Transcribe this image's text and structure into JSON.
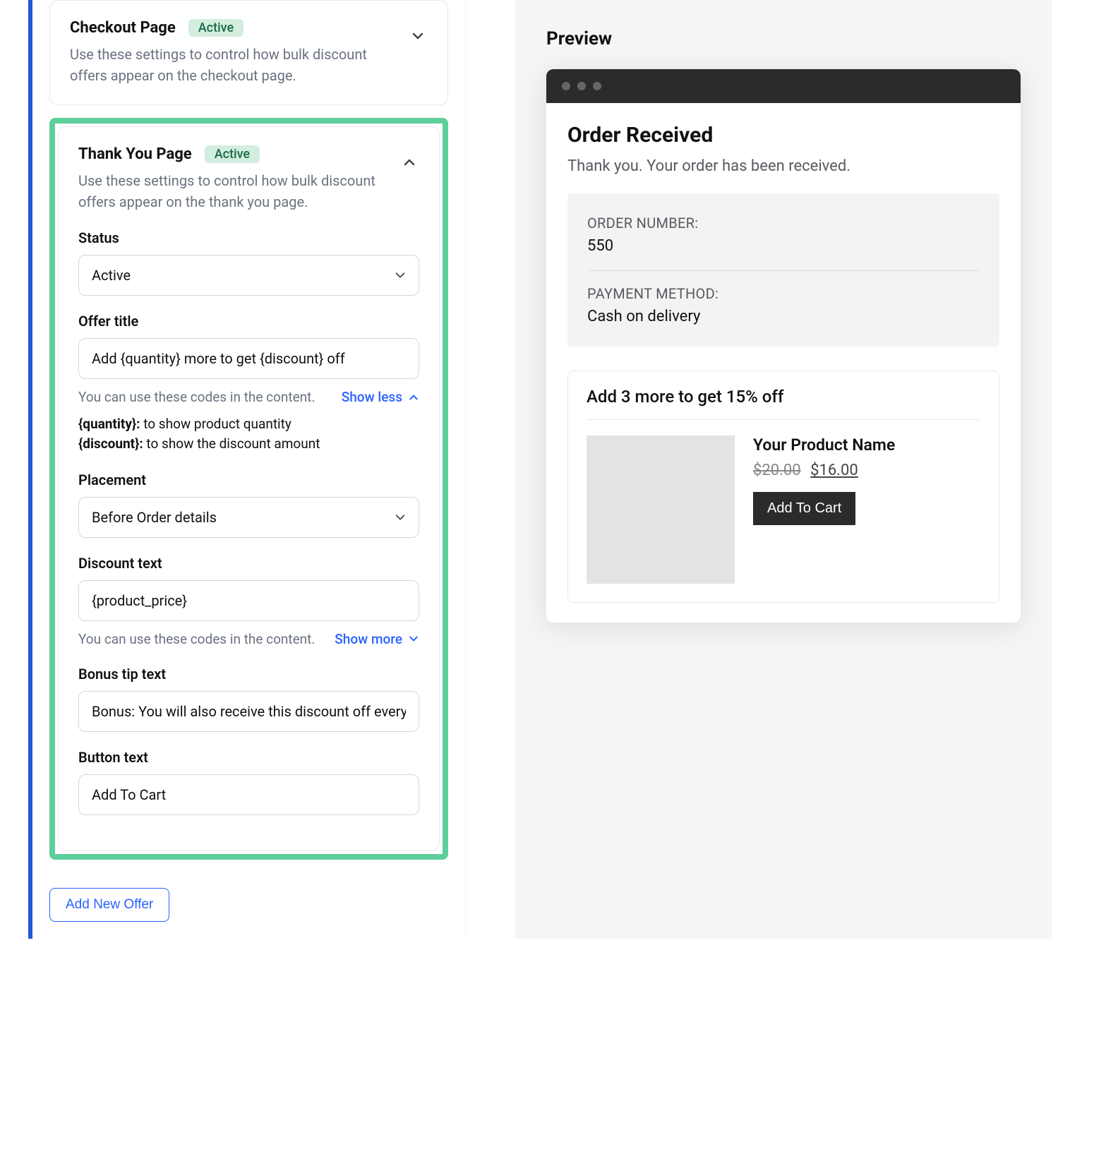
{
  "colors": {
    "accent": "#2a62ff",
    "highlight": "#5ece9b"
  },
  "checkout_card": {
    "title": "Checkout Page",
    "badge": "Active",
    "desc": "Use these settings to control how bulk discount offers appear on the checkout page."
  },
  "thankyou_card": {
    "title": "Thank You Page",
    "badge": "Active",
    "desc": "Use these settings to control how bulk discount offers appear on the thank you page.",
    "status_label": "Status",
    "status_value": "Active",
    "offer_title_label": "Offer title",
    "offer_title_value": "Add {quantity} more to get {discount} off",
    "codes_hint": "You can use these codes in the content.",
    "show_less": "Show less",
    "code_quantity_key": "{quantity}:",
    "code_quantity_val": " to show product quantity",
    "code_discount_key": "{discount}:",
    "code_discount_val": " to show the discount amount",
    "placement_label": "Placement",
    "placement_value": "Before Order details",
    "discount_text_label": "Discount text",
    "discount_text_value": "{product_price}",
    "codes_hint2": "You can use these codes in the content.",
    "show_more": "Show more",
    "bonus_label": "Bonus tip text",
    "bonus_value": "Bonus: You will also receive this discount off every unit you purchase!",
    "button_text_label": "Button text",
    "button_text_value": "Add To Cart"
  },
  "add_new_offer": "Add New Offer",
  "preview": {
    "label": "Preview",
    "heading": "Order Received",
    "subheading": "Thank you. Your order has been received.",
    "order_number_key": "ORDER NUMBER:",
    "order_number_val": "550",
    "payment_key": "PAYMENT METHOD:",
    "payment_val": "Cash on delivery",
    "offer_title": "Add 3 more to get 15% off",
    "product_name": "Your Product Name",
    "old_price": "$20.00",
    "new_price": "$16.00",
    "atc": "Add To Cart"
  }
}
